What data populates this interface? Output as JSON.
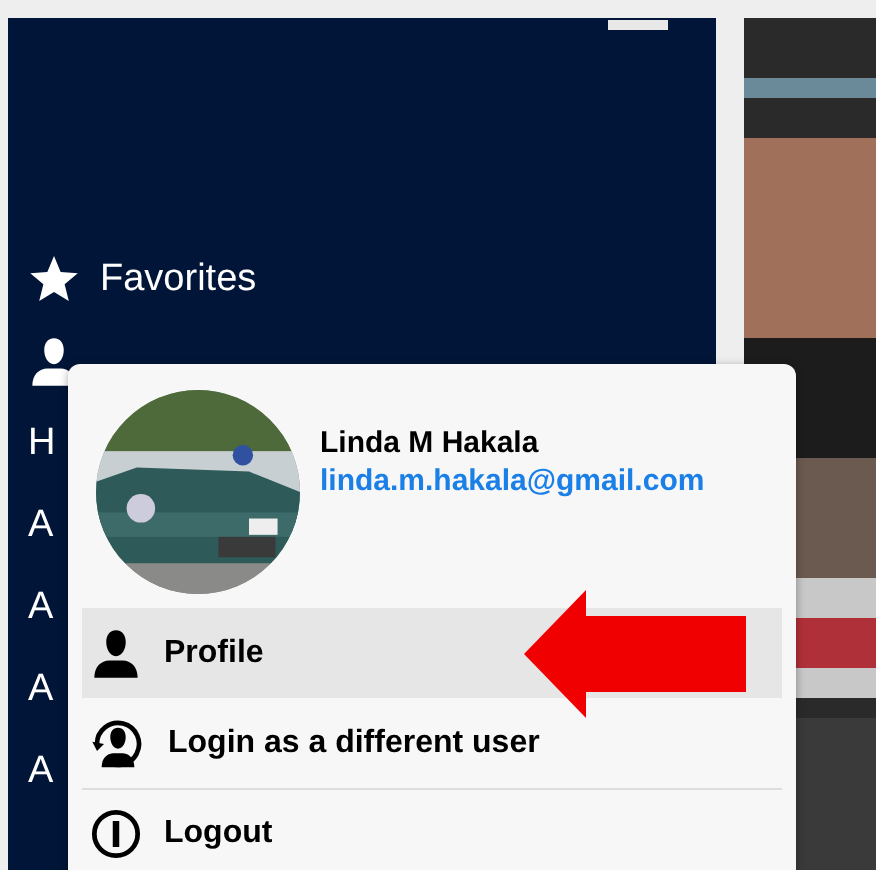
{
  "sidebar": {
    "items": [
      {
        "kind": "favorites",
        "label": "Favorites"
      },
      {
        "kind": "user"
      },
      {
        "kind": "plain",
        "label": "H"
      },
      {
        "kind": "plain",
        "label": "A"
      },
      {
        "kind": "plain",
        "label": "A"
      },
      {
        "kind": "plain",
        "label": "A"
      },
      {
        "kind": "plain",
        "label": "A"
      }
    ]
  },
  "user_menu": {
    "name": "Linda M Hakala",
    "email": "linda.m.hakala@gmail.com",
    "items": [
      {
        "kind": "profile",
        "label": "Profile",
        "selected": true
      },
      {
        "kind": "switch",
        "label": "Login as a different user",
        "selected": false
      },
      {
        "kind": "logout",
        "label": "Logout",
        "selected": false
      }
    ]
  }
}
